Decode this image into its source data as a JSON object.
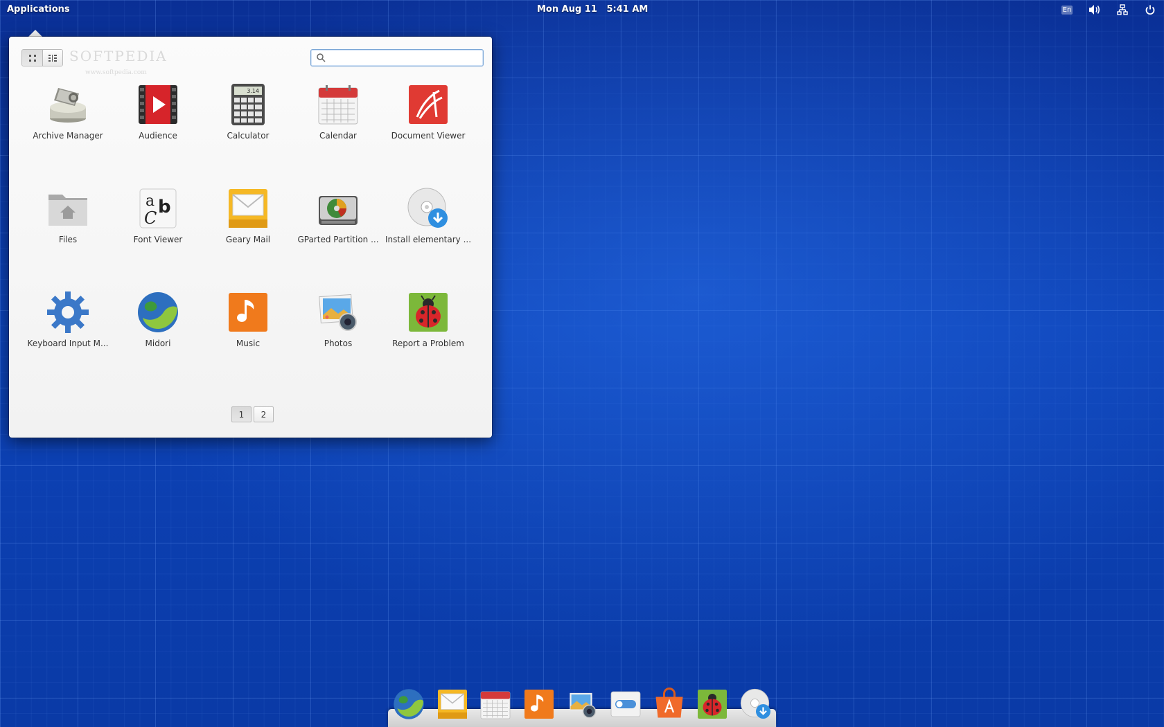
{
  "panel": {
    "applications_label": "Applications",
    "date": "Mon Aug 11",
    "time": "5:41 AM",
    "keyboard_layout": "En",
    "tray_icons": [
      "keyboard-layout-icon",
      "volume-icon",
      "network-icon",
      "power-icon"
    ]
  },
  "launcher": {
    "watermark": "SOFTPEDIA",
    "watermark_sub": "www.softpedia.com",
    "view_modes": [
      "grid-view-icon",
      "category-view-icon"
    ],
    "search": {
      "value": "",
      "placeholder": ""
    },
    "apps": [
      {
        "label": "Archive Manager",
        "icon": "archive-manager-icon"
      },
      {
        "label": "Audience",
        "icon": "audience-icon"
      },
      {
        "label": "Calculator",
        "icon": "calculator-icon"
      },
      {
        "label": "Calendar",
        "icon": "calendar-icon"
      },
      {
        "label": "Document Viewer",
        "icon": "document-viewer-icon"
      },
      {
        "label": "Files",
        "icon": "files-icon"
      },
      {
        "label": "Font Viewer",
        "icon": "font-viewer-icon"
      },
      {
        "label": "Geary Mail",
        "icon": "geary-mail-icon"
      },
      {
        "label": "GParted Partition ...",
        "icon": "gparted-icon"
      },
      {
        "label": "Install elementary ...",
        "icon": "install-elementary-icon"
      },
      {
        "label": "Keyboard Input M...",
        "icon": "keyboard-input-icon"
      },
      {
        "label": "Midori",
        "icon": "midori-icon"
      },
      {
        "label": "Music",
        "icon": "music-icon"
      },
      {
        "label": "Photos",
        "icon": "photos-icon"
      },
      {
        "label": "Report a Problem",
        "icon": "report-problem-icon"
      }
    ],
    "calculator_display": "3.14",
    "pages": [
      "1",
      "2"
    ],
    "current_page": "1"
  },
  "dock": {
    "items": [
      "midori-icon",
      "geary-mail-icon",
      "calendar-icon",
      "music-icon",
      "photos-icon",
      "settings-icon",
      "app-center-icon",
      "report-problem-icon",
      "install-elementary-icon"
    ]
  },
  "colors": {
    "desktop": "#0b3aa8",
    "accent": "#7aa6d6"
  }
}
